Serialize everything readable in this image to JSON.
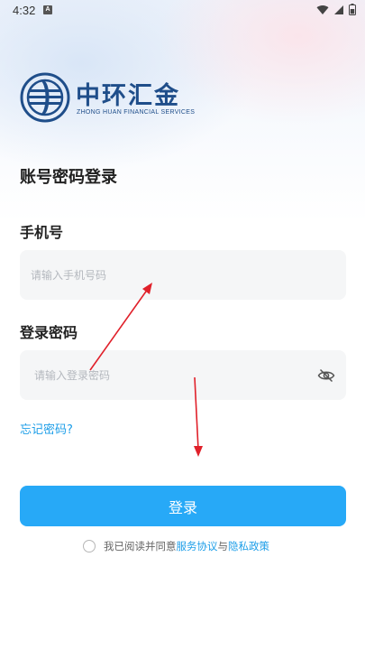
{
  "status_bar": {
    "time": "4:32",
    "notification_glyph": "A",
    "icons": [
      "wifi-icon",
      "signal-icon",
      "battery-icon"
    ]
  },
  "brand": {
    "name_cn": "中环汇金",
    "name_en": "ZHONG HUAN FINANCIAL SERVICES",
    "color": "#1f4e8a"
  },
  "login": {
    "title": "账号密码登录",
    "phone_label": "手机号",
    "phone_placeholder": "请输入手机号码",
    "phone_value": "",
    "password_label": "登录密码",
    "password_placeholder": "请输入登录密码",
    "password_value": "",
    "password_toggle_icon": "eye-off-icon",
    "forgot_password": "忘记密码?",
    "submit_label": "登录"
  },
  "agreement": {
    "prefix": "我已阅读并同意",
    "terms_link": "服务协议",
    "conjunction": "与",
    "privacy_link": "隐私政策",
    "checked": false
  },
  "colors": {
    "accent": "#27a9f7",
    "link": "#1d9ee8",
    "input_background": "#f5f6f7",
    "annotation_arrow": "#e0202a"
  }
}
